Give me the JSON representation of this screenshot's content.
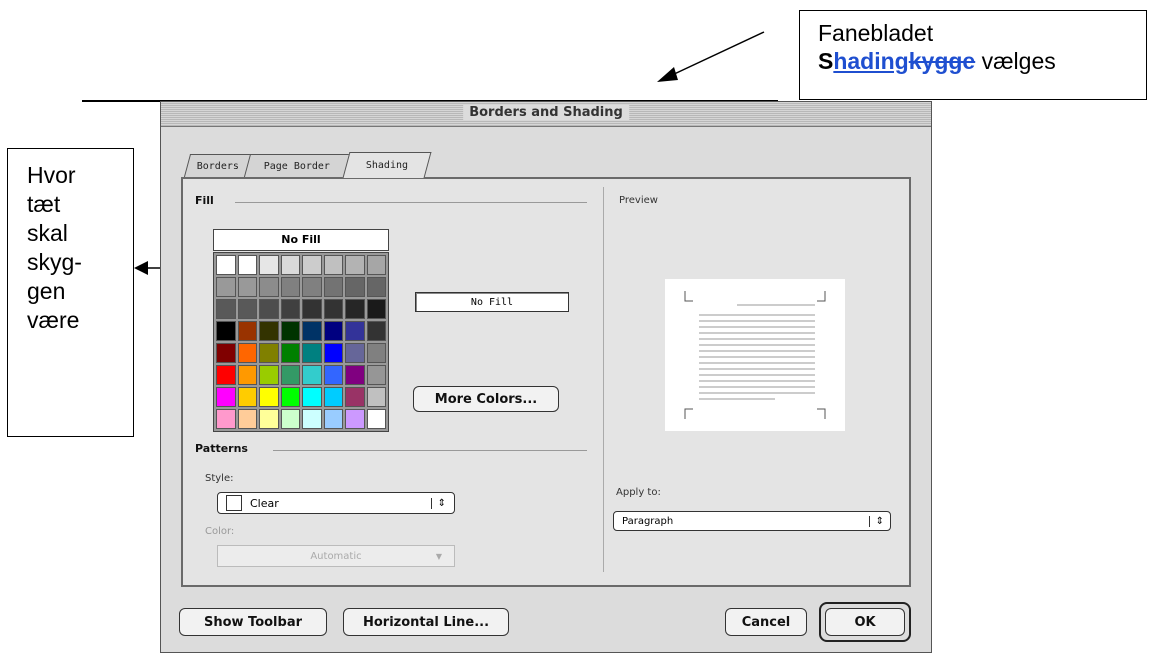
{
  "annotations": {
    "top_line1": "Fanebladet",
    "top_s": "S",
    "top_shading": "hading",
    "top_strike": "kygge",
    "top_rest": " vælges",
    "left_lines": [
      "Hvor",
      "tæt",
      "skal",
      "skyg-",
      "gen",
      "være"
    ]
  },
  "dialog": {
    "title": "Borders and Shading",
    "tabs": [
      "Borders",
      "Page Border",
      "Shading"
    ],
    "active_tab": "Shading",
    "fill": {
      "label": "Fill",
      "no_fill_header": "No Fill",
      "selected_name": "No Fill",
      "more_colors": "More Colors...",
      "palette": [
        [
          "#ffffff",
          "#ffffff",
          "#e6e6e6",
          "#d9d9d9",
          "#cccccc",
          "#c0c0c0",
          "#b3b3b3",
          "#a6a6a6"
        ],
        [
          "#999999",
          "#999999",
          "#8c8c8c",
          "#808080",
          "#808080",
          "#737373",
          "#666666",
          "#666666"
        ],
        [
          "#595959",
          "#595959",
          "#4d4d4d",
          "#404040",
          "#333333",
          "#333333",
          "#262626",
          "#1a1a1a"
        ],
        [
          "#000000",
          "#993300",
          "#333300",
          "#003300",
          "#003366",
          "#000080",
          "#333399",
          "#333333"
        ],
        [
          "#800000",
          "#ff6600",
          "#808000",
          "#008000",
          "#008080",
          "#0000ff",
          "#666699",
          "#808080"
        ],
        [
          "#ff0000",
          "#ff9900",
          "#99cc00",
          "#339966",
          "#33cccc",
          "#3366ff",
          "#800080",
          "#969696"
        ],
        [
          "#ff00ff",
          "#ffcc00",
          "#ffff00",
          "#00ff00",
          "#00ffff",
          "#00ccff",
          "#993366",
          "#c0c0c0"
        ],
        [
          "#ff99cc",
          "#ffcc99",
          "#ffff99",
          "#ccffcc",
          "#ccffff",
          "#99ccff",
          "#cc99ff",
          "#ffffff"
        ]
      ]
    },
    "patterns": {
      "label": "Patterns",
      "style_label": "Style:",
      "style_value": "Clear",
      "color_label": "Color:",
      "color_value": "Automatic"
    },
    "preview": {
      "label": "Preview"
    },
    "apply": {
      "label": "Apply to:",
      "value": "Paragraph"
    },
    "buttons": {
      "show_toolbar": "Show Toolbar",
      "horizontal_line": "Horizontal Line...",
      "cancel": "Cancel",
      "ok": "OK"
    }
  }
}
